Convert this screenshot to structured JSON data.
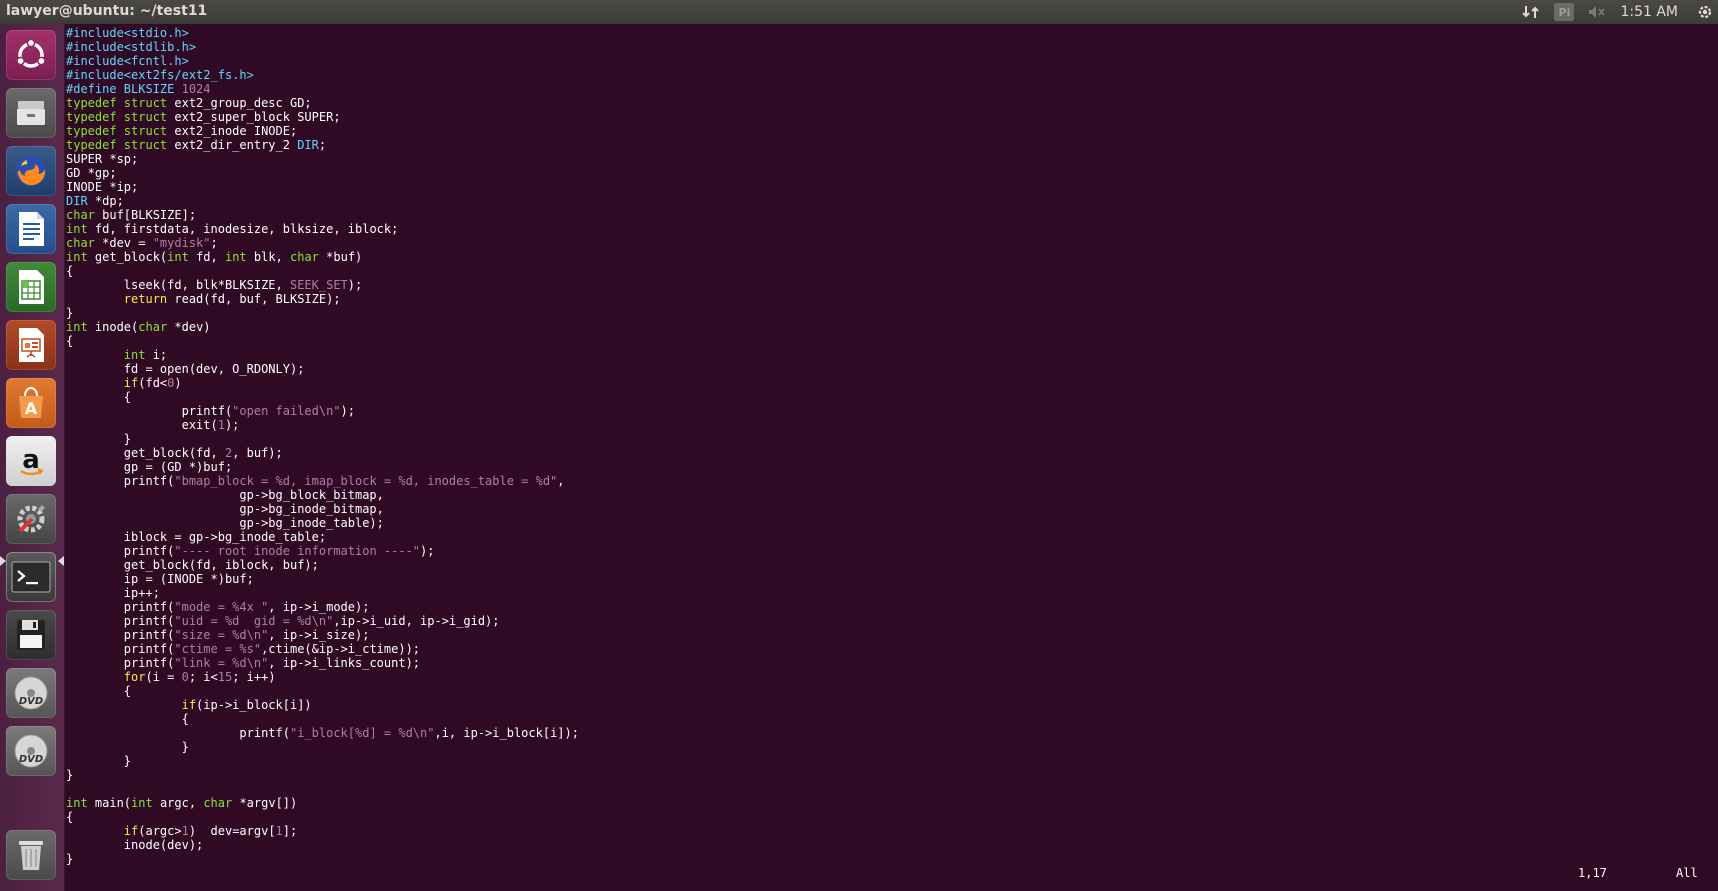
{
  "window": {
    "title": "lawyer@ubuntu: ~/test11"
  },
  "panel": {
    "clock": "1:51 AM",
    "keyboard_label": "Pi"
  },
  "launcher": {
    "items": [
      {
        "name": "ubuntu-dash-icon"
      },
      {
        "name": "files-icon"
      },
      {
        "name": "firefox-icon"
      },
      {
        "name": "writer-icon"
      },
      {
        "name": "calc-icon"
      },
      {
        "name": "impress-icon"
      },
      {
        "name": "software-center-icon"
      },
      {
        "name": "amazon-icon"
      },
      {
        "name": "system-settings-icon"
      },
      {
        "name": "terminal-icon"
      },
      {
        "name": "save-disk-icon"
      },
      {
        "name": "dvd-icon"
      },
      {
        "name": "dvd-icon-2"
      },
      {
        "name": "trash-icon"
      }
    ]
  },
  "colors": {
    "background": "#300a24",
    "preprocessor": "#5fd7ff",
    "type": "#8ae234",
    "constant": "#ad7fa8",
    "statement": "#fce94f"
  },
  "editor": {
    "lines": [
      [
        [
          "#include<stdio.h>",
          "pp"
        ]
      ],
      [
        [
          "#include<stdlib.h>",
          "pp"
        ]
      ],
      [
        [
          "#include<fcntl.h>",
          "pp"
        ]
      ],
      [
        [
          "#include<ext2fs/ext2_fs.h>",
          "pp"
        ]
      ],
      [
        [
          "#define BLKSIZE ",
          "pp"
        ],
        [
          "1024",
          "num"
        ]
      ],
      [
        [
          "typedef struct",
          "ty"
        ],
        [
          " ext2_group_desc GD;",
          ""
        ]
      ],
      [
        [
          "typedef struct",
          "ty"
        ],
        [
          " ext2_super_block SUPER;",
          ""
        ]
      ],
      [
        [
          "typedef struct",
          "ty"
        ],
        [
          " ext2_inode INODE;",
          ""
        ]
      ],
      [
        [
          "typedef struct",
          "ty"
        ],
        [
          " ext2_dir_entry_2 ",
          ""
        ],
        [
          "DIR",
          "pp"
        ],
        [
          ";",
          ""
        ]
      ],
      [
        [
          "SUPER *sp;",
          ""
        ]
      ],
      [
        [
          "GD *gp;",
          ""
        ]
      ],
      [
        [
          "INODE *ip;",
          ""
        ]
      ],
      [
        [
          "DIR",
          "pp"
        ],
        [
          " *dp;",
          ""
        ]
      ],
      [
        [
          "char",
          "ty"
        ],
        [
          " buf[BLKSIZE];",
          ""
        ]
      ],
      [
        [
          "int",
          "ty"
        ],
        [
          " fd, firstdata, inodesize, blksize, iblock;",
          ""
        ]
      ],
      [
        [
          "char",
          "ty"
        ],
        [
          " *dev = ",
          ""
        ],
        [
          "\"mydisk\"",
          "str"
        ],
        [
          ";",
          ""
        ]
      ],
      [
        [
          "int",
          "ty"
        ],
        [
          " get_block(",
          ""
        ],
        [
          "int",
          "ty"
        ],
        [
          " fd, ",
          ""
        ],
        [
          "int",
          "ty"
        ],
        [
          " blk, ",
          ""
        ],
        [
          "char",
          "ty"
        ],
        [
          " *buf)",
          ""
        ]
      ],
      [
        [
          "{",
          ""
        ]
      ],
      [
        [
          "        lseek(fd, blk*BLKSIZE, ",
          ""
        ],
        [
          "SEEK_SET",
          "str"
        ],
        [
          ");",
          ""
        ]
      ],
      [
        [
          "        ",
          ""
        ],
        [
          "return",
          "kw"
        ],
        [
          " read(fd, buf, BLKSIZE);",
          ""
        ]
      ],
      [
        [
          "}",
          ""
        ]
      ],
      [
        [
          "int",
          "ty"
        ],
        [
          " inode(",
          ""
        ],
        [
          "char",
          "ty"
        ],
        [
          " *dev)",
          ""
        ]
      ],
      [
        [
          "{",
          ""
        ]
      ],
      [
        [
          "        ",
          ""
        ],
        [
          "int",
          "ty"
        ],
        [
          " i;",
          ""
        ]
      ],
      [
        [
          "        fd = open(dev, O_RDONLY);",
          ""
        ]
      ],
      [
        [
          "        ",
          ""
        ],
        [
          "if",
          "kw"
        ],
        [
          "(fd<",
          ""
        ],
        [
          "0",
          "num"
        ],
        [
          ")",
          ""
        ]
      ],
      [
        [
          "        {",
          ""
        ]
      ],
      [
        [
          "                printf(",
          ""
        ],
        [
          "\"open failed\\n\"",
          "str"
        ],
        [
          ");",
          ""
        ]
      ],
      [
        [
          "                exit(",
          ""
        ],
        [
          "1",
          "num"
        ],
        [
          ");",
          ""
        ]
      ],
      [
        [
          "        }",
          ""
        ]
      ],
      [
        [
          "        get_block(fd, ",
          ""
        ],
        [
          "2",
          "num"
        ],
        [
          ", buf);",
          ""
        ]
      ],
      [
        [
          "        gp = (GD *)buf;",
          ""
        ]
      ],
      [
        [
          "        printf(",
          ""
        ],
        [
          "\"bmap_block = %d, imap_block = %d, inodes_table = %d\"",
          "str"
        ],
        [
          ",",
          ""
        ]
      ],
      [
        [
          "                        gp->bg_block_bitmap,",
          ""
        ]
      ],
      [
        [
          "                        gp->bg_inode_bitmap,",
          ""
        ]
      ],
      [
        [
          "                        gp->bg_inode_table);",
          ""
        ]
      ],
      [
        [
          "        iblock = gp->bg_inode_table;",
          ""
        ]
      ],
      [
        [
          "        printf(",
          ""
        ],
        [
          "\"---- root inode information ----\"",
          "str"
        ],
        [
          ");",
          ""
        ]
      ],
      [
        [
          "        get_block(fd, iblock, buf);",
          ""
        ]
      ],
      [
        [
          "        ip = (INODE *)buf;",
          ""
        ]
      ],
      [
        [
          "        ip++;",
          ""
        ]
      ],
      [
        [
          "        printf(",
          ""
        ],
        [
          "\"mode = %4x \"",
          "str"
        ],
        [
          ", ip->i_mode);",
          ""
        ]
      ],
      [
        [
          "        printf(",
          ""
        ],
        [
          "\"uid = %d  gid = %d\\n\"",
          "str"
        ],
        [
          ",ip->i_uid, ip->i_gid);",
          ""
        ]
      ],
      [
        [
          "        printf(",
          ""
        ],
        [
          "\"size = %d\\n\"",
          "str"
        ],
        [
          ", ip->i_size);",
          ""
        ]
      ],
      [
        [
          "        printf(",
          ""
        ],
        [
          "\"ctime = %s\"",
          "str"
        ],
        [
          ",ctime(&ip->i_ctime));",
          ""
        ]
      ],
      [
        [
          "        printf(",
          ""
        ],
        [
          "\"link = %d\\n\"",
          "str"
        ],
        [
          ", ip->i_links_count);",
          ""
        ]
      ],
      [
        [
          "        ",
          ""
        ],
        [
          "for",
          "kw"
        ],
        [
          "(i = ",
          ""
        ],
        [
          "0",
          "num"
        ],
        [
          "; i<",
          ""
        ],
        [
          "15",
          "num"
        ],
        [
          "; i++)",
          ""
        ]
      ],
      [
        [
          "        {",
          ""
        ]
      ],
      [
        [
          "                ",
          ""
        ],
        [
          "if",
          "kw"
        ],
        [
          "(ip->i_block[i])",
          ""
        ]
      ],
      [
        [
          "                {",
          ""
        ]
      ],
      [
        [
          "                        printf(",
          ""
        ],
        [
          "\"i_block[%d] = %d\\n\"",
          "str"
        ],
        [
          ",i, ip->i_block[i]);",
          ""
        ]
      ],
      [
        [
          "                }",
          ""
        ]
      ],
      [
        [
          "        }",
          ""
        ]
      ],
      [
        [
          "}",
          ""
        ]
      ],
      [
        [
          "",
          ""
        ]
      ],
      [
        [
          "int",
          "ty"
        ],
        [
          " main(",
          ""
        ],
        [
          "int",
          "ty"
        ],
        [
          " argc, ",
          ""
        ],
        [
          "char",
          "ty"
        ],
        [
          " *argv[])",
          ""
        ]
      ],
      [
        [
          "{",
          ""
        ]
      ],
      [
        [
          "        ",
          ""
        ],
        [
          "if",
          "kw"
        ],
        [
          "(argc>",
          ""
        ],
        [
          "1",
          "num"
        ],
        [
          ")  dev=argv[",
          ""
        ],
        [
          "1",
          "num"
        ],
        [
          "];",
          ""
        ]
      ],
      [
        [
          "        inode(dev);",
          ""
        ]
      ],
      [
        [
          "}",
          ""
        ]
      ]
    ]
  },
  "status": {
    "position": "1,17",
    "scroll": "All"
  }
}
